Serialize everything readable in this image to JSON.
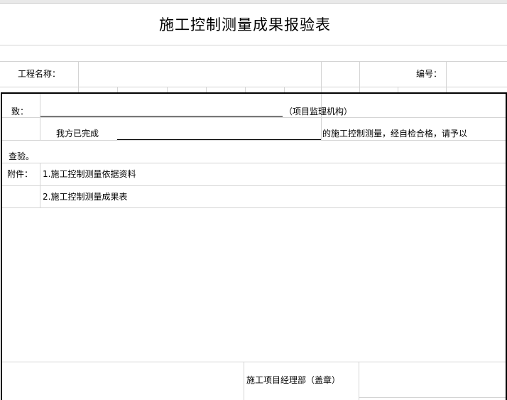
{
  "form": {
    "title": "施工控制测量成果报验表",
    "project_name_label": "工程名称：",
    "number_label": "编号：",
    "to_label": "致：",
    "supervisor_org": "（项目监理机构）",
    "completed_label": "我方已完成",
    "completed_suffix": "的施工控制测量，经自检合格，请予以",
    "inspection": "查验。",
    "attachment_label": "附件：",
    "attachments": [
      "1.施工控制测量依据资料",
      "2.施工控制测量成果表"
    ],
    "signature_label": "施工项目经理部（盖章）"
  }
}
